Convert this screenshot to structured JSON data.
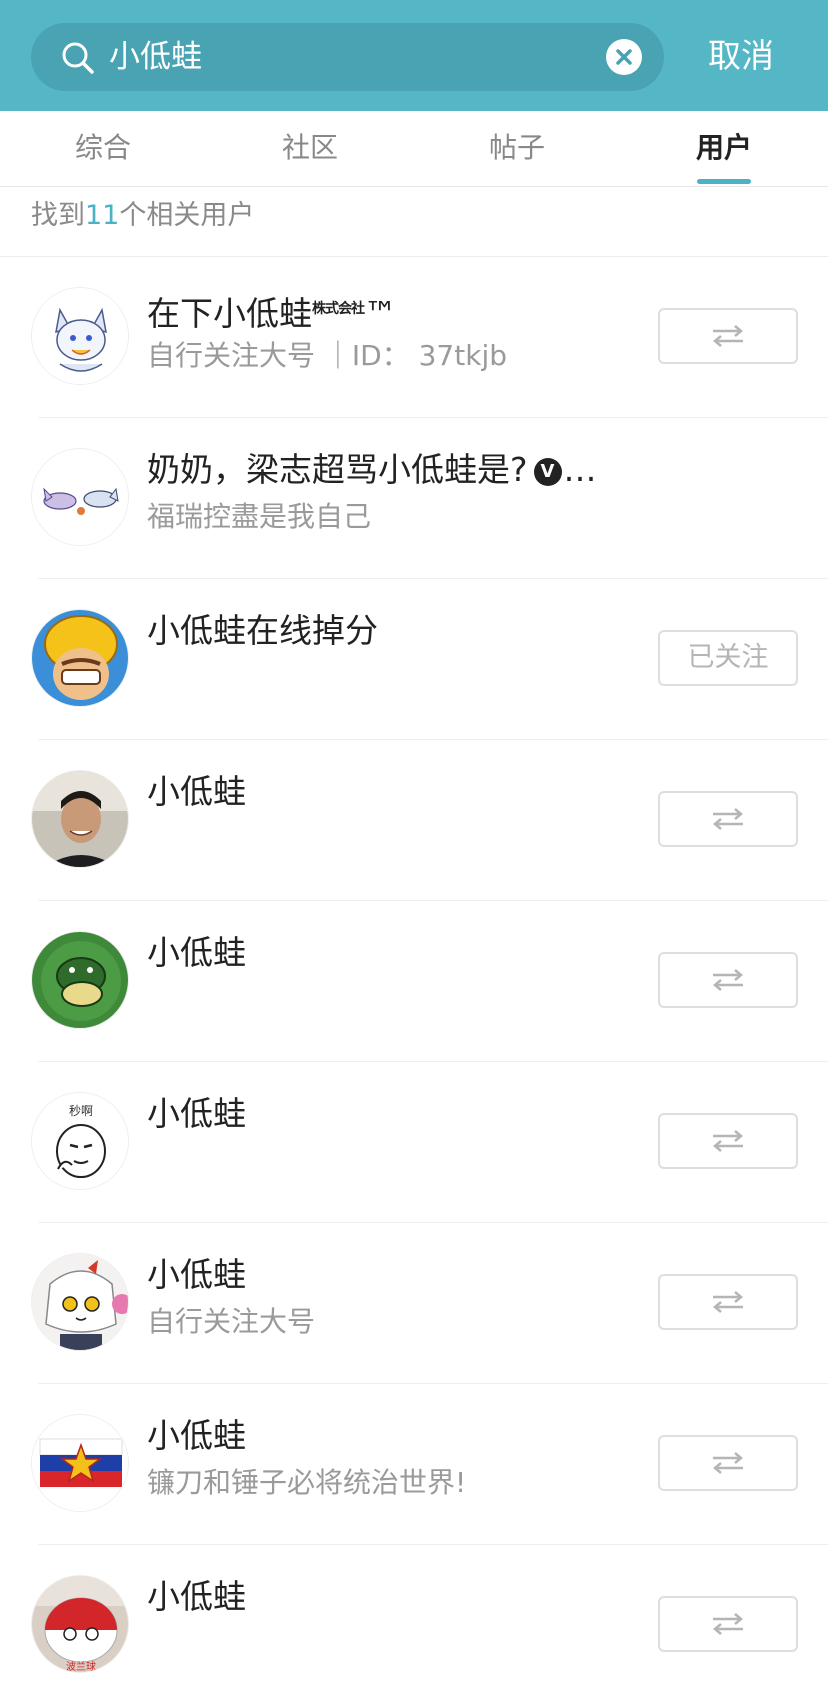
{
  "search": {
    "query": "小低蛙",
    "cancel_label": "取消"
  },
  "tabs": [
    {
      "label": "综合"
    },
    {
      "label": "社区"
    },
    {
      "label": "帖子"
    },
    {
      "label": "用户",
      "active": true
    }
  ],
  "results": {
    "prefix": "找到",
    "count": "11",
    "suffix": "个相关用户"
  },
  "users": [
    {
      "name": "在下小低蛙",
      "name_mark": "株式会社",
      "name_tm": "™",
      "sub": "自行关注大号 ｜ID： 37tkjb",
      "follow_state": "follow",
      "avatar": "anime-dog-drawing"
    },
    {
      "name": "奶奶，梁志超骂小低蛙是?",
      "verified": "V",
      "truncation": "…",
      "sub": "福瑞控盡是我自己",
      "follow_state": "none",
      "avatar": "furry-sketch"
    },
    {
      "name": "小低蛙在线掉分",
      "sub": "",
      "follow_state": "followed",
      "followed_label": "已关注",
      "avatar": "clash-barbarian"
    },
    {
      "name": "小低蛙",
      "sub": "",
      "follow_state": "follow",
      "avatar": "man-photo"
    },
    {
      "name": "小低蛙",
      "sub": "",
      "follow_state": "follow",
      "avatar": "green-dragon"
    },
    {
      "name": "小低蛙",
      "sub": "",
      "follow_state": "follow",
      "avatar": "meme-face",
      "avatar_text": "秒啊"
    },
    {
      "name": "小低蛙",
      "sub": "自行关注大号",
      "follow_state": "follow",
      "avatar": "anime-girl"
    },
    {
      "name": "小低蛙",
      "sub": "镰刀和锤子必将统治世界!",
      "follow_state": "follow",
      "avatar": "flag-star"
    },
    {
      "name": "小低蛙",
      "sub": "",
      "follow_state": "follow",
      "avatar": "polandball",
      "avatar_text": "波兰球"
    }
  ],
  "colors": {
    "header_bg": "#55b7c6",
    "search_bg": "#4aa3b2",
    "accent": "#4ab2c4",
    "button_border": "#dedede"
  },
  "icons": {
    "search": "search-icon",
    "clear": "clear-icon",
    "follow": "mutual-follow-arrows-icon"
  }
}
